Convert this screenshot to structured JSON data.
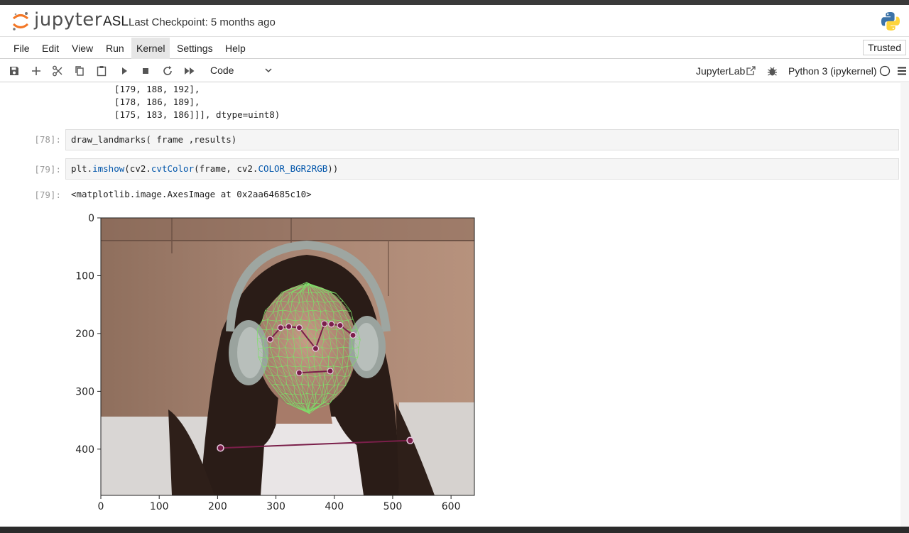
{
  "header": {
    "app_name": "jupyter",
    "notebook_title": "ASL",
    "checkpoint": "Last Checkpoint: 5 months ago"
  },
  "menu": {
    "items": [
      "File",
      "Edit",
      "View",
      "Run",
      "Kernel",
      "Settings",
      "Help"
    ],
    "active": "Kernel",
    "trusted_label": "Trusted"
  },
  "toolbar": {
    "cell_type": "Code",
    "jupyterlab_label": "JupyterLab",
    "kernel_label": "Python 3 (ipykernel)"
  },
  "cells": {
    "prev_output_lines": [
      "[179, 188, 192],",
      "[178, 186, 189],",
      "[175, 183, 186]]], dtype=uint8)"
    ],
    "cell78": {
      "prompt": "[78]:",
      "code": "draw_landmarks( frame ,results)"
    },
    "cell79": {
      "prompt": "[79]:",
      "code_parts": [
        "plt.",
        "imshow",
        "(cv2.",
        "cvtColor",
        "(frame, cv2.",
        "COLOR_BGR2RGB",
        "))"
      ],
      "out_prompt": "[79]:",
      "output_text": "<matplotlib.image.AxesImage at 0x2aa64685c10>"
    }
  },
  "chart_data": {
    "type": "image",
    "x_ticks": [
      "0",
      "100",
      "200",
      "300",
      "400",
      "500",
      "600"
    ],
    "y_ticks": [
      "0",
      "100",
      "200",
      "300",
      "400"
    ],
    "xlim": [
      0,
      640
    ],
    "ylim": [
      480,
      0
    ],
    "pose_landmarks": [
      [
        205,
        398
      ],
      [
        530,
        385
      ]
    ],
    "face_keypoints": [
      [
        290,
        210
      ],
      [
        308,
        190
      ],
      [
        322,
        188
      ],
      [
        340,
        190
      ],
      [
        368,
        226
      ],
      [
        383,
        183
      ],
      [
        395,
        184
      ],
      [
        410,
        186
      ],
      [
        432,
        203
      ],
      [
        340,
        268
      ],
      [
        393,
        265
      ]
    ],
    "colors": {
      "mesh": "#7ee06a",
      "landmark": "#7a1f4a",
      "landmark_ring": "#e9c9e0"
    }
  }
}
